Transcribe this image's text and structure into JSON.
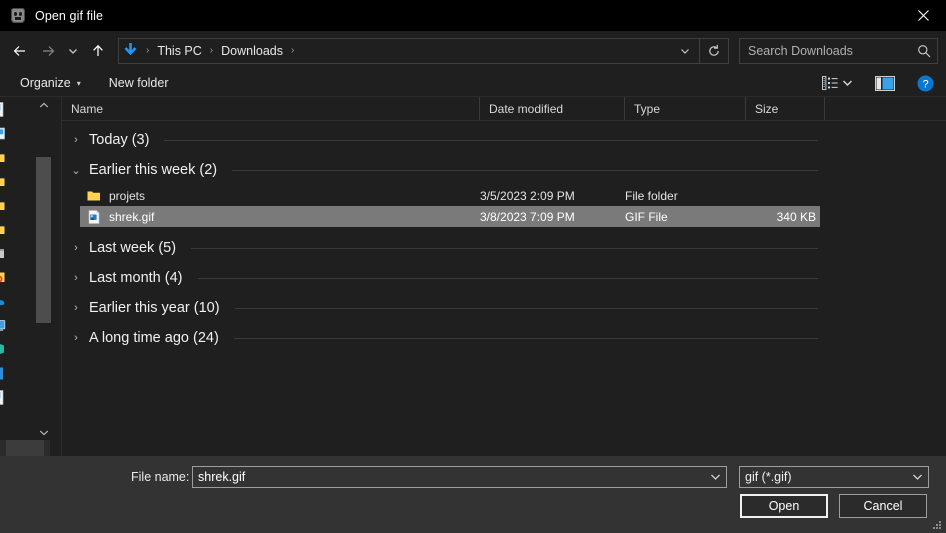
{
  "window": {
    "title": "Open gif file",
    "app_icon": "app-cube-icon",
    "close_label": "✕"
  },
  "nav": {
    "back": "back-arrow-icon",
    "forward": "forward-arrow-icon",
    "recent": "recent-locations-chevron-icon",
    "up": "up-arrow-icon",
    "breadcrumb_icon": "downloads-arrow-icon",
    "breadcrumbs": [
      "This PC",
      "Downloads"
    ],
    "separator": "›",
    "dropdown": "chevron-down-icon",
    "refresh": "refresh-icon",
    "search": {
      "placeholder": "Search Downloads",
      "value": "",
      "icon": "search-icon"
    }
  },
  "commandbar": {
    "organize": "Organize",
    "organize_caret": "▾",
    "new_folder": "New folder",
    "view_icon": "list-view-icon",
    "view_caret": "▾",
    "preview_pane_icon": "preview-pane-icon",
    "help_icon": "help-icon",
    "help_glyph": "?"
  },
  "navpane": {
    "items": [
      {
        "name": "nav-item-documents",
        "icon": "document-icon"
      },
      {
        "name": "nav-item-pictures",
        "icon": "pictures-icon"
      },
      {
        "name": "nav-item-folder-1",
        "icon": "folder-icon"
      },
      {
        "name": "nav-item-folder-2",
        "icon": "folder-icon"
      },
      {
        "name": "nav-item-folder-3",
        "icon": "folder-icon"
      },
      {
        "name": "nav-item-folder-4",
        "icon": "folder-icon"
      },
      {
        "name": "nav-item-archive",
        "icon": "archive-icon"
      },
      {
        "name": "nav-item-folder-special",
        "icon": "folder-special-icon"
      },
      {
        "name": "nav-item-onedrive",
        "icon": "onedrive-cloud-icon"
      },
      {
        "name": "nav-item-this-pc",
        "icon": "this-pc-icon"
      },
      {
        "name": "nav-item-network",
        "icon": "network-icon"
      },
      {
        "name": "nav-item-drive",
        "icon": "drive-icon"
      },
      {
        "name": "nav-item-document-2",
        "icon": "document-icon"
      }
    ],
    "scroll_up": "⌃",
    "scroll_down": "⌄"
  },
  "filelist": {
    "columns": [
      {
        "key": "name",
        "label": "Name"
      },
      {
        "key": "date",
        "label": "Date modified"
      },
      {
        "key": "type",
        "label": "Type"
      },
      {
        "key": "size",
        "label": "Size"
      }
    ],
    "sort_indicator": "⌃",
    "groups": [
      {
        "label": "Today (3)",
        "expanded": false,
        "chevron": "›",
        "items": []
      },
      {
        "label": "Earlier this week (2)",
        "expanded": true,
        "chevron": "⌄",
        "items": [
          {
            "name": "projets",
            "date": "3/5/2023 2:09 PM",
            "type": "File folder",
            "size": "",
            "icon": "folder-icon",
            "selected": false
          },
          {
            "name": "shrek.gif",
            "date": "3/8/2023 7:09 PM",
            "type": "GIF File",
            "size": "340 KB",
            "icon": "gif-file-icon",
            "selected": true
          }
        ]
      },
      {
        "label": "Last week (5)",
        "expanded": false,
        "chevron": "›",
        "items": []
      },
      {
        "label": "Last month (4)",
        "expanded": false,
        "chevron": "›",
        "items": []
      },
      {
        "label": "Earlier this year (10)",
        "expanded": false,
        "chevron": "›",
        "items": []
      },
      {
        "label": "A long time ago (24)",
        "expanded": false,
        "chevron": "›",
        "items": []
      }
    ]
  },
  "footer": {
    "filename_label": "File name:",
    "filename_value": "shrek.gif",
    "filename_caret": "⌄",
    "filter_value": "gif (*.gif)",
    "filter_caret": "⌄",
    "open_label": "Open",
    "cancel_label": "Cancel"
  },
  "colors": {
    "window_bg": "#1f1f1f",
    "titlebar_bg": "#000000",
    "footer_bg": "#333333",
    "accent_blue": "#0b86e0",
    "selection_gray": "#7a7a7a",
    "folder_yellow": "#ffd351",
    "text": "#e6e6e6"
  }
}
